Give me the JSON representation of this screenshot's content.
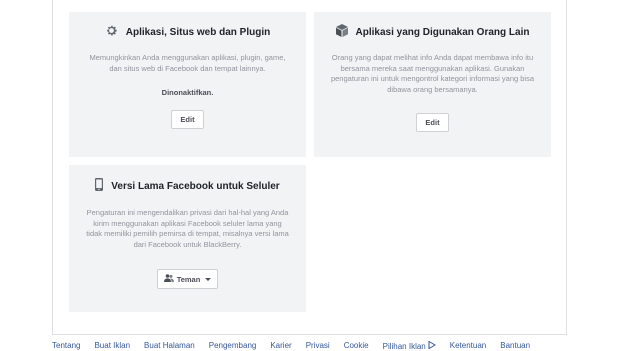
{
  "cards": {
    "apps": {
      "title": "Aplikasi, Situs web dan Plugin",
      "icon": "gear-icon",
      "description": "Memungkinkan Anda menggunakan aplikasi, plugin, game, dan situs web di Facebook dan tempat lainnya.",
      "status": "Dinonaktifkan.",
      "button": "Edit"
    },
    "others": {
      "title": "Aplikasi yang Digunakan Orang Lain",
      "icon": "box-icon",
      "description": "Orang yang dapat melihat info Anda dapat membawa info itu bersama mereka saat menggunakan aplikasi. Gunakan pengaturan ini untuk mengontrol kategori informasi yang bisa dibawa orang bersamanya.",
      "button": "Edit"
    },
    "mobile": {
      "title": "Versi Lama Facebook untuk Seluler",
      "icon": "mobile-phone-icon",
      "description": "Pengaturan ini mengendalikan privasi dari hal-hal yang Anda kirim menggunakan aplikasi Facebook seluler lama yang tidak memiliki pemilih pemirsa di tempat, misalnya versi lama dari Facebook untuk BlackBerry.",
      "button": "Teman"
    }
  },
  "footer": {
    "links": [
      "Tentang",
      "Buat Iklan",
      "Buat Halaman",
      "Pengembang",
      "Karier",
      "Privasi",
      "Cookie",
      "Pilihan Iklan",
      "Ketentuan",
      "Bantuan"
    ]
  },
  "colors": {
    "card_bg": "#f2f3f5",
    "link": "#365899",
    "muted_text": "#90949c"
  }
}
